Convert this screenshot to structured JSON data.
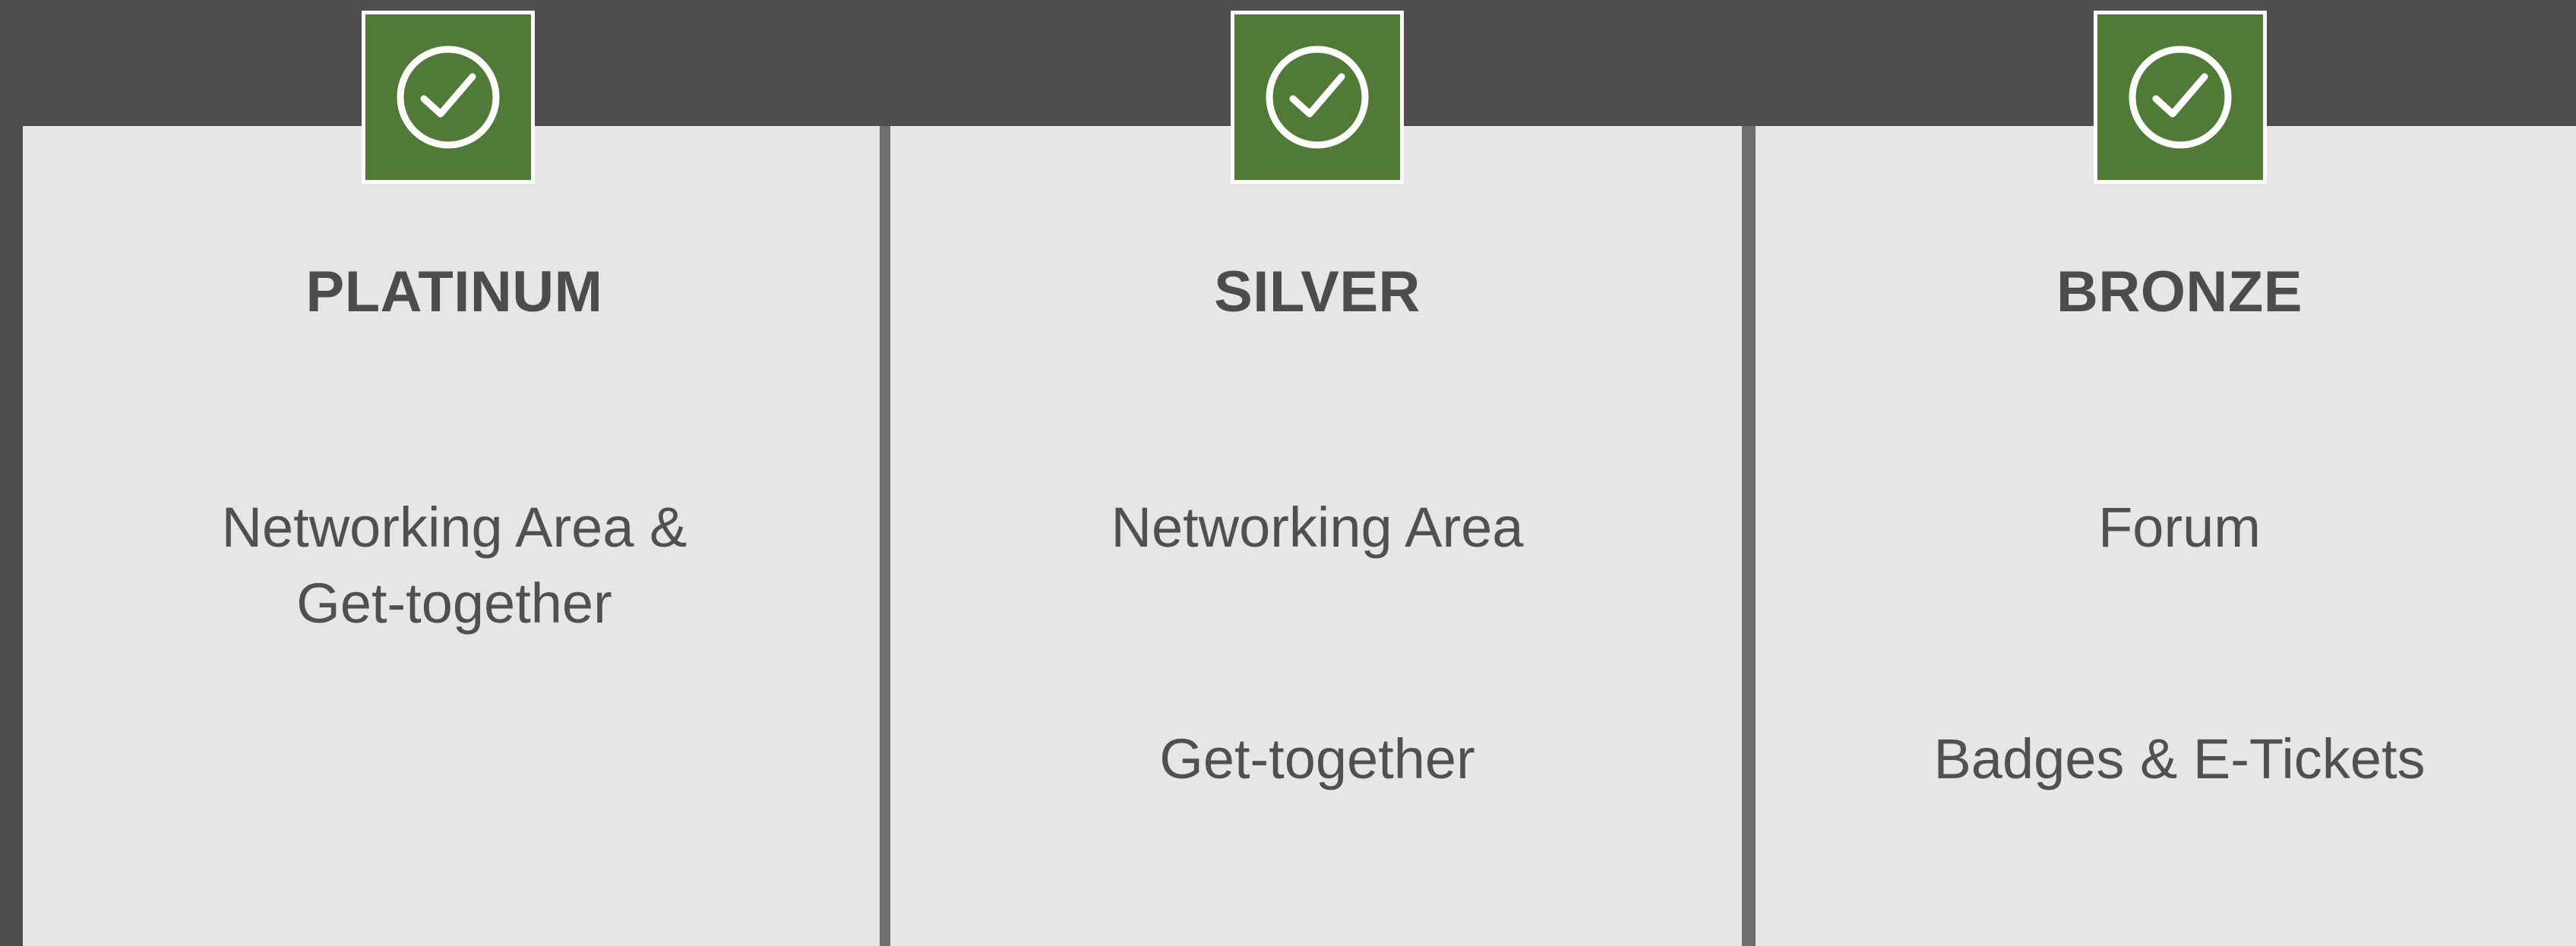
{
  "tiers": [
    {
      "name": "PLATINUM",
      "features": [
        "Networking Area &\nGet-together"
      ]
    },
    {
      "name": "SILVER",
      "features": [
        "Networking Area",
        "Get-together"
      ]
    },
    {
      "name": "BRONZE",
      "features": [
        "Forum",
        "Badges & E-Tickets"
      ]
    }
  ],
  "icons": {
    "tier_icon": "check-circle-icon"
  },
  "colors": {
    "background": "#504e4f",
    "panel": "#e6e6e6",
    "divider": "#6f6d6e",
    "badge": "#527a37",
    "badge_border": "#ffffff",
    "text": "#4d4b4c"
  }
}
